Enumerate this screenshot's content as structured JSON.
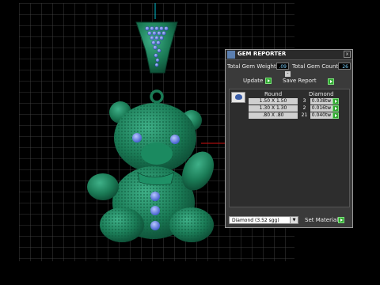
{
  "panel": {
    "title": "GEM REPORTER",
    "close_glyph": "x",
    "total_weight_label": "Total Gem Weight",
    "total_weight_value": ".09",
    "total_count_label": "Total Gem Count",
    "total_count_value": "26",
    "collapse_glyph": "-",
    "update_label": "Update",
    "save_report_label": "Save Report",
    "table": {
      "headers": [
        "Round",
        "Diamond"
      ],
      "rows": [
        {
          "size": "1.50 X 1.50",
          "count": "3",
          "weight": "0.038tw"
        },
        {
          "size": "1.30 X 1.30",
          "count": "2",
          "weight": "0.016tw"
        },
        {
          "size": ".80 X .80",
          "count": "21",
          "weight": "0.040tw"
        }
      ]
    },
    "material_select": "Diamond     (3.52 sgg)",
    "dropdown_glyph": "▼",
    "set_material_label": "Set Material"
  },
  "icons": {
    "app": "gem-reporter-app-icon",
    "gem": "round-gem-icon",
    "go": "green-play-icon"
  },
  "colors": {
    "model": "#1e7f5a",
    "gems": "#3a6fd8",
    "grid": "#555555",
    "accent_go": "#2fa82f"
  }
}
